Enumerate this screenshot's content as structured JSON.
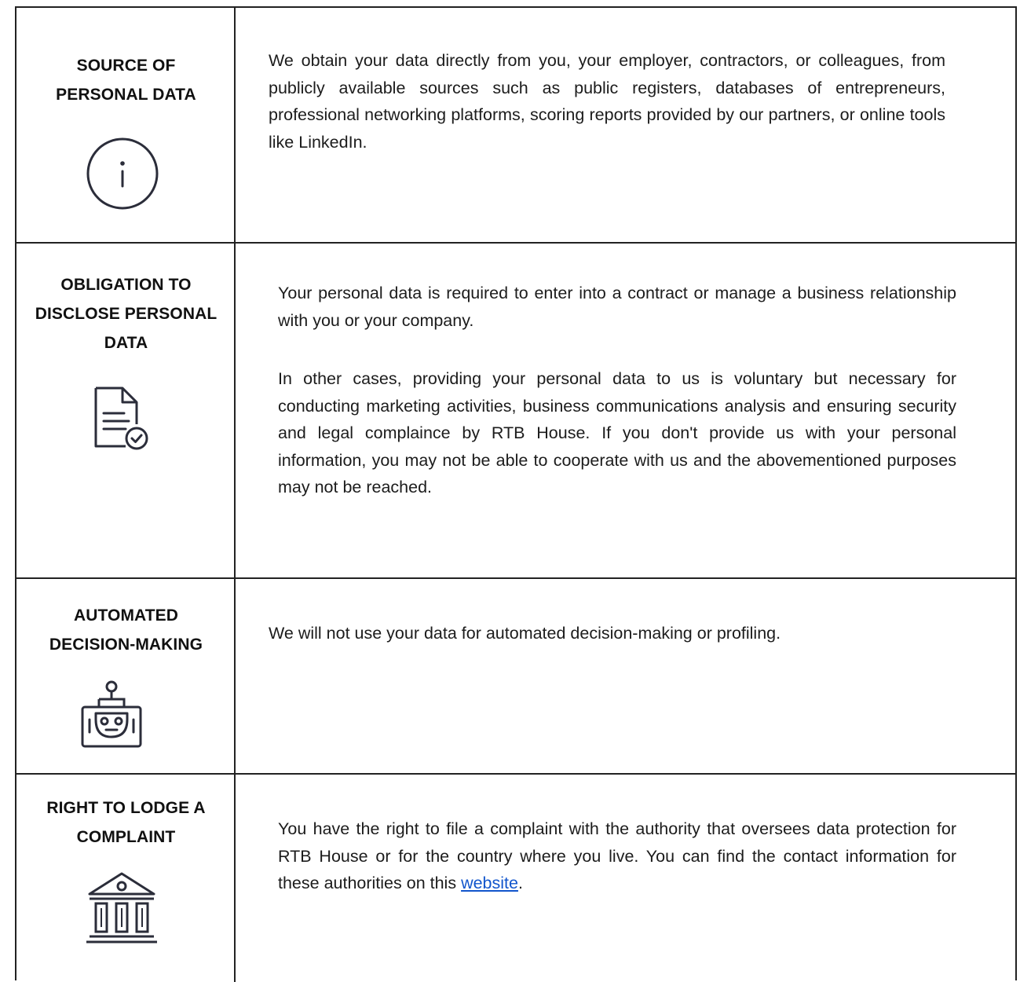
{
  "rows": [
    {
      "heading_line1": "SOURCE OF",
      "heading_line2": "PERSONAL DATA",
      "icon": "info-icon",
      "text": "We obtain your data directly from you, your employer, contractors, or colleagues,  from publicly available sources such as public registers, databases of entrepreneurs, professional networking platforms, scoring reports provided by our partners, or online tools like LinkedIn."
    },
    {
      "heading_line1": "OBLIGATION TO",
      "heading_line2": "DISCLOSE PERSONAL",
      "heading_line3": "DATA",
      "icon": "document-check-icon",
      "text_p1": "Your personal data is required to enter into a contract or manage a business relationship with you or your company.",
      "text_p2": "In other cases, providing your personal data to us is voluntary but necessary for conducting marketing activities, business communications analysis and ensuring security and legal complaince by RTB House. If you don't provide us with your personal information, you may not be able to cooperate with us and the abovementioned purposes may not be reached."
    },
    {
      "heading_line1": "AUTOMATED",
      "heading_line2": "DECISION-MAKING",
      "icon": "robot-icon",
      "text": "We will not use your data for automated decision-making or profiling."
    },
    {
      "heading_line1": "RIGHT TO LODGE A",
      "heading_line2": "COMPLAINT",
      "icon": "courthouse-icon",
      "text_before_link": "You have the right to file a complaint with the authority that oversees data protection for RTB House or for the country where you live. You can find the contact information for these authorities on this ",
      "link_text": "website",
      "text_after_link": "."
    }
  ],
  "colors": {
    "border": "#222222",
    "icon_stroke": "#2b2d3a",
    "link": "#1155cc"
  }
}
